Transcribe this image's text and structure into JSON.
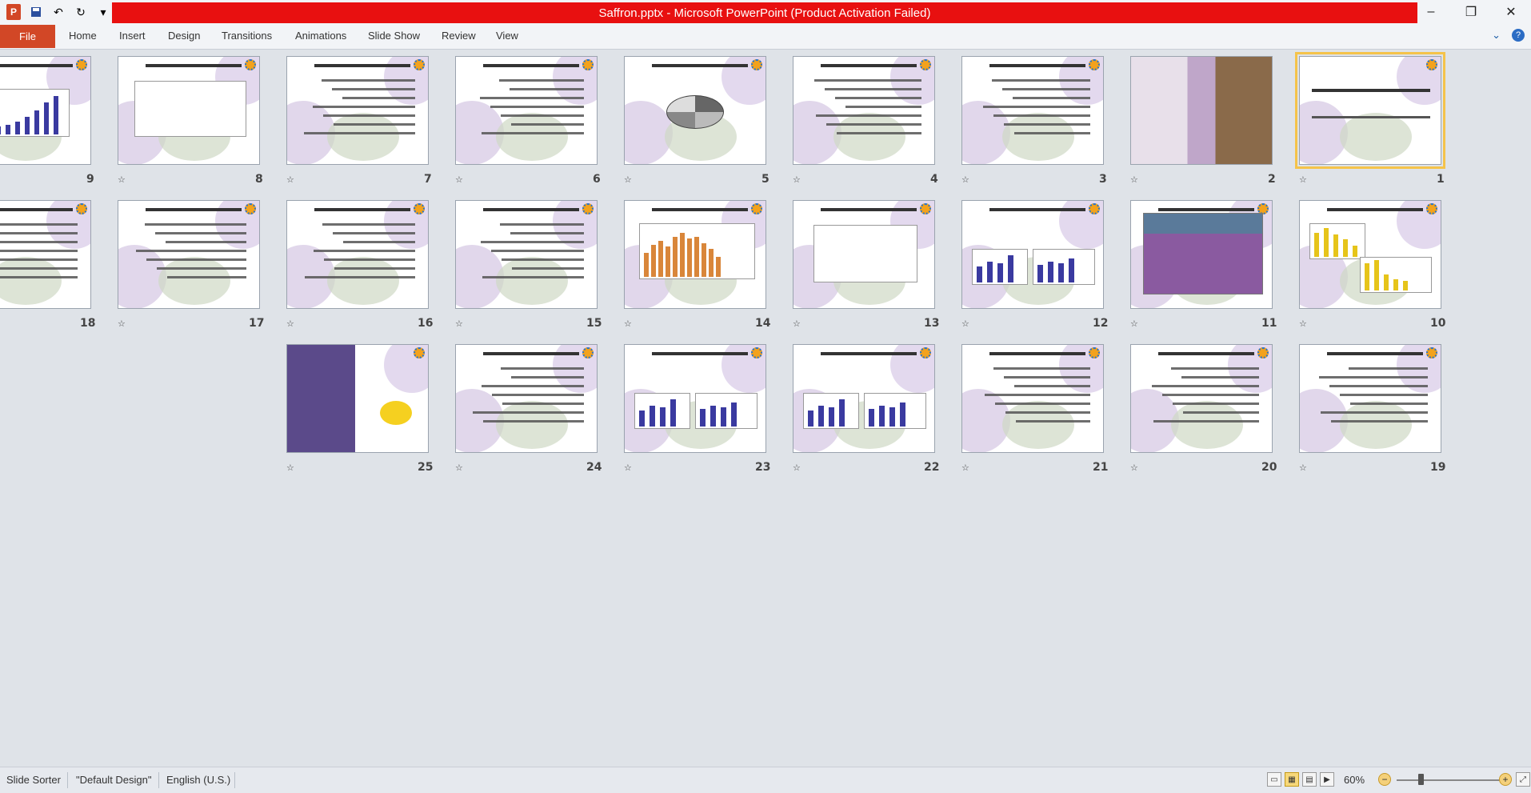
{
  "window": {
    "title": "Saffron.pptx  -  Microsoft PowerPoint (Product Activation Failed)",
    "controls": {
      "minimize": "–",
      "maximize": "❐",
      "close": "✕"
    }
  },
  "quick_access": {
    "app_icon": "P",
    "save": "save-icon",
    "undo": "undo-icon",
    "redo": "redo-icon",
    "customize": "customize-icon"
  },
  "ribbon": {
    "file_label": "File",
    "tabs": [
      "Home",
      "Insert",
      "Design",
      "Transitions",
      "Animations",
      "Slide Show",
      "Review",
      "View"
    ],
    "collapse_icon": "chevron-down-icon",
    "help_label": "?"
  },
  "slides": [
    {
      "number": "1"
    },
    {
      "number": "2"
    },
    {
      "number": "3"
    },
    {
      "number": "4"
    },
    {
      "number": "5"
    },
    {
      "number": "6"
    },
    {
      "number": "7"
    },
    {
      "number": "8"
    },
    {
      "number": "9"
    },
    {
      "number": "10"
    },
    {
      "number": "11"
    },
    {
      "number": "12"
    },
    {
      "number": "13"
    },
    {
      "number": "14"
    },
    {
      "number": "15"
    },
    {
      "number": "16"
    },
    {
      "number": "17"
    },
    {
      "number": "18"
    },
    {
      "number": "19"
    },
    {
      "number": "20"
    },
    {
      "number": "21"
    },
    {
      "number": "22"
    },
    {
      "number": "23"
    },
    {
      "number": "24"
    },
    {
      "number": "25"
    }
  ],
  "selected_slide": "1",
  "transition_icon": "☆",
  "statusbar": {
    "view": "Slide Sorter",
    "theme": "\"Default Design\"",
    "language": "English (U.S.)",
    "zoom": "60%",
    "zoom_out": "−",
    "zoom_in": "+"
  }
}
